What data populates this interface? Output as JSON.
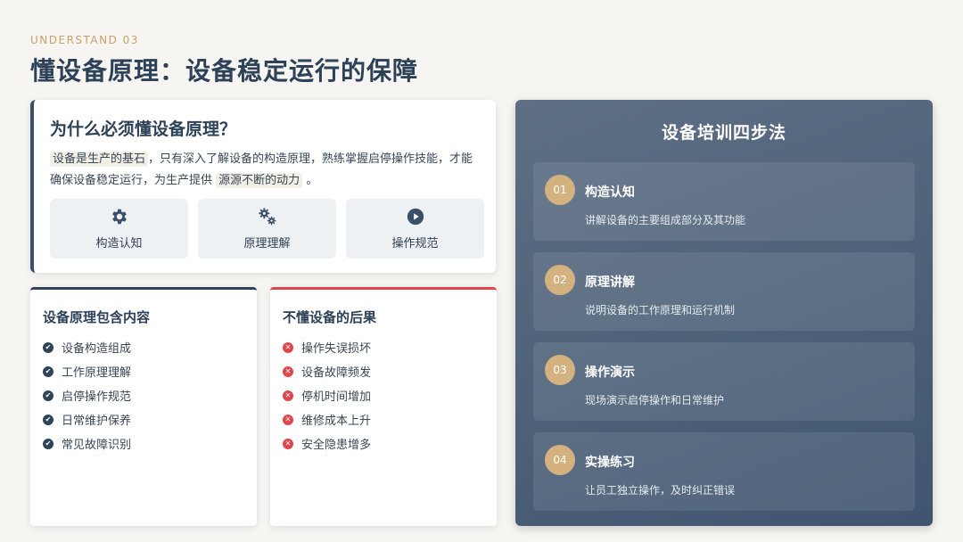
{
  "header": {
    "kicker": "UNDERSTAND 03",
    "title": "懂设备原理：设备稳定运行的保障"
  },
  "why_card": {
    "title": "为什么必须懂设备原理？",
    "text": {
      "hl1": "设备是生产的基石",
      "mid": "，只有深入了解设备的构造原理，熟练掌握启停操作技能，才能确保设备稳定运行，为生产提供",
      "hl2": "源源不断的动力",
      "end": "。"
    },
    "tiles": [
      {
        "label": "构造认知",
        "icon": "gear-icon"
      },
      {
        "label": "原理理解",
        "icon": "gears-icon"
      },
      {
        "label": "操作规范",
        "icon": "play-circle-icon"
      }
    ]
  },
  "contents_card": {
    "title": "设备原理包含内容",
    "items": [
      "设备构造组成",
      "工作原理理解",
      "启停操作规范",
      "日常维护保养",
      "常见故障识别"
    ],
    "accent": "#2f4358"
  },
  "consequences_card": {
    "title": "不懂设备的后果",
    "items": [
      "操作失误损坏",
      "设备故障频发",
      "停机时间增加",
      "维修成本上升",
      "安全隐患增多"
    ],
    "accent": "#e0474c"
  },
  "steps_panel": {
    "title": "设备培训四步法",
    "steps": [
      {
        "num": "01",
        "title": "构造认知",
        "desc": "讲解设备的主要组成部分及其功能"
      },
      {
        "num": "02",
        "title": "原理讲解",
        "desc": "说明设备的工作原理和运行机制"
      },
      {
        "num": "03",
        "title": "操作演示",
        "desc": "现场演示启停操作和日常维护"
      },
      {
        "num": "04",
        "title": "实操练习",
        "desc": "让员工独立操作，及时纠正错误"
      }
    ]
  },
  "colors": {
    "navy": "#2d4157",
    "gold": "#d4b27f",
    "red": "#e0474c"
  }
}
